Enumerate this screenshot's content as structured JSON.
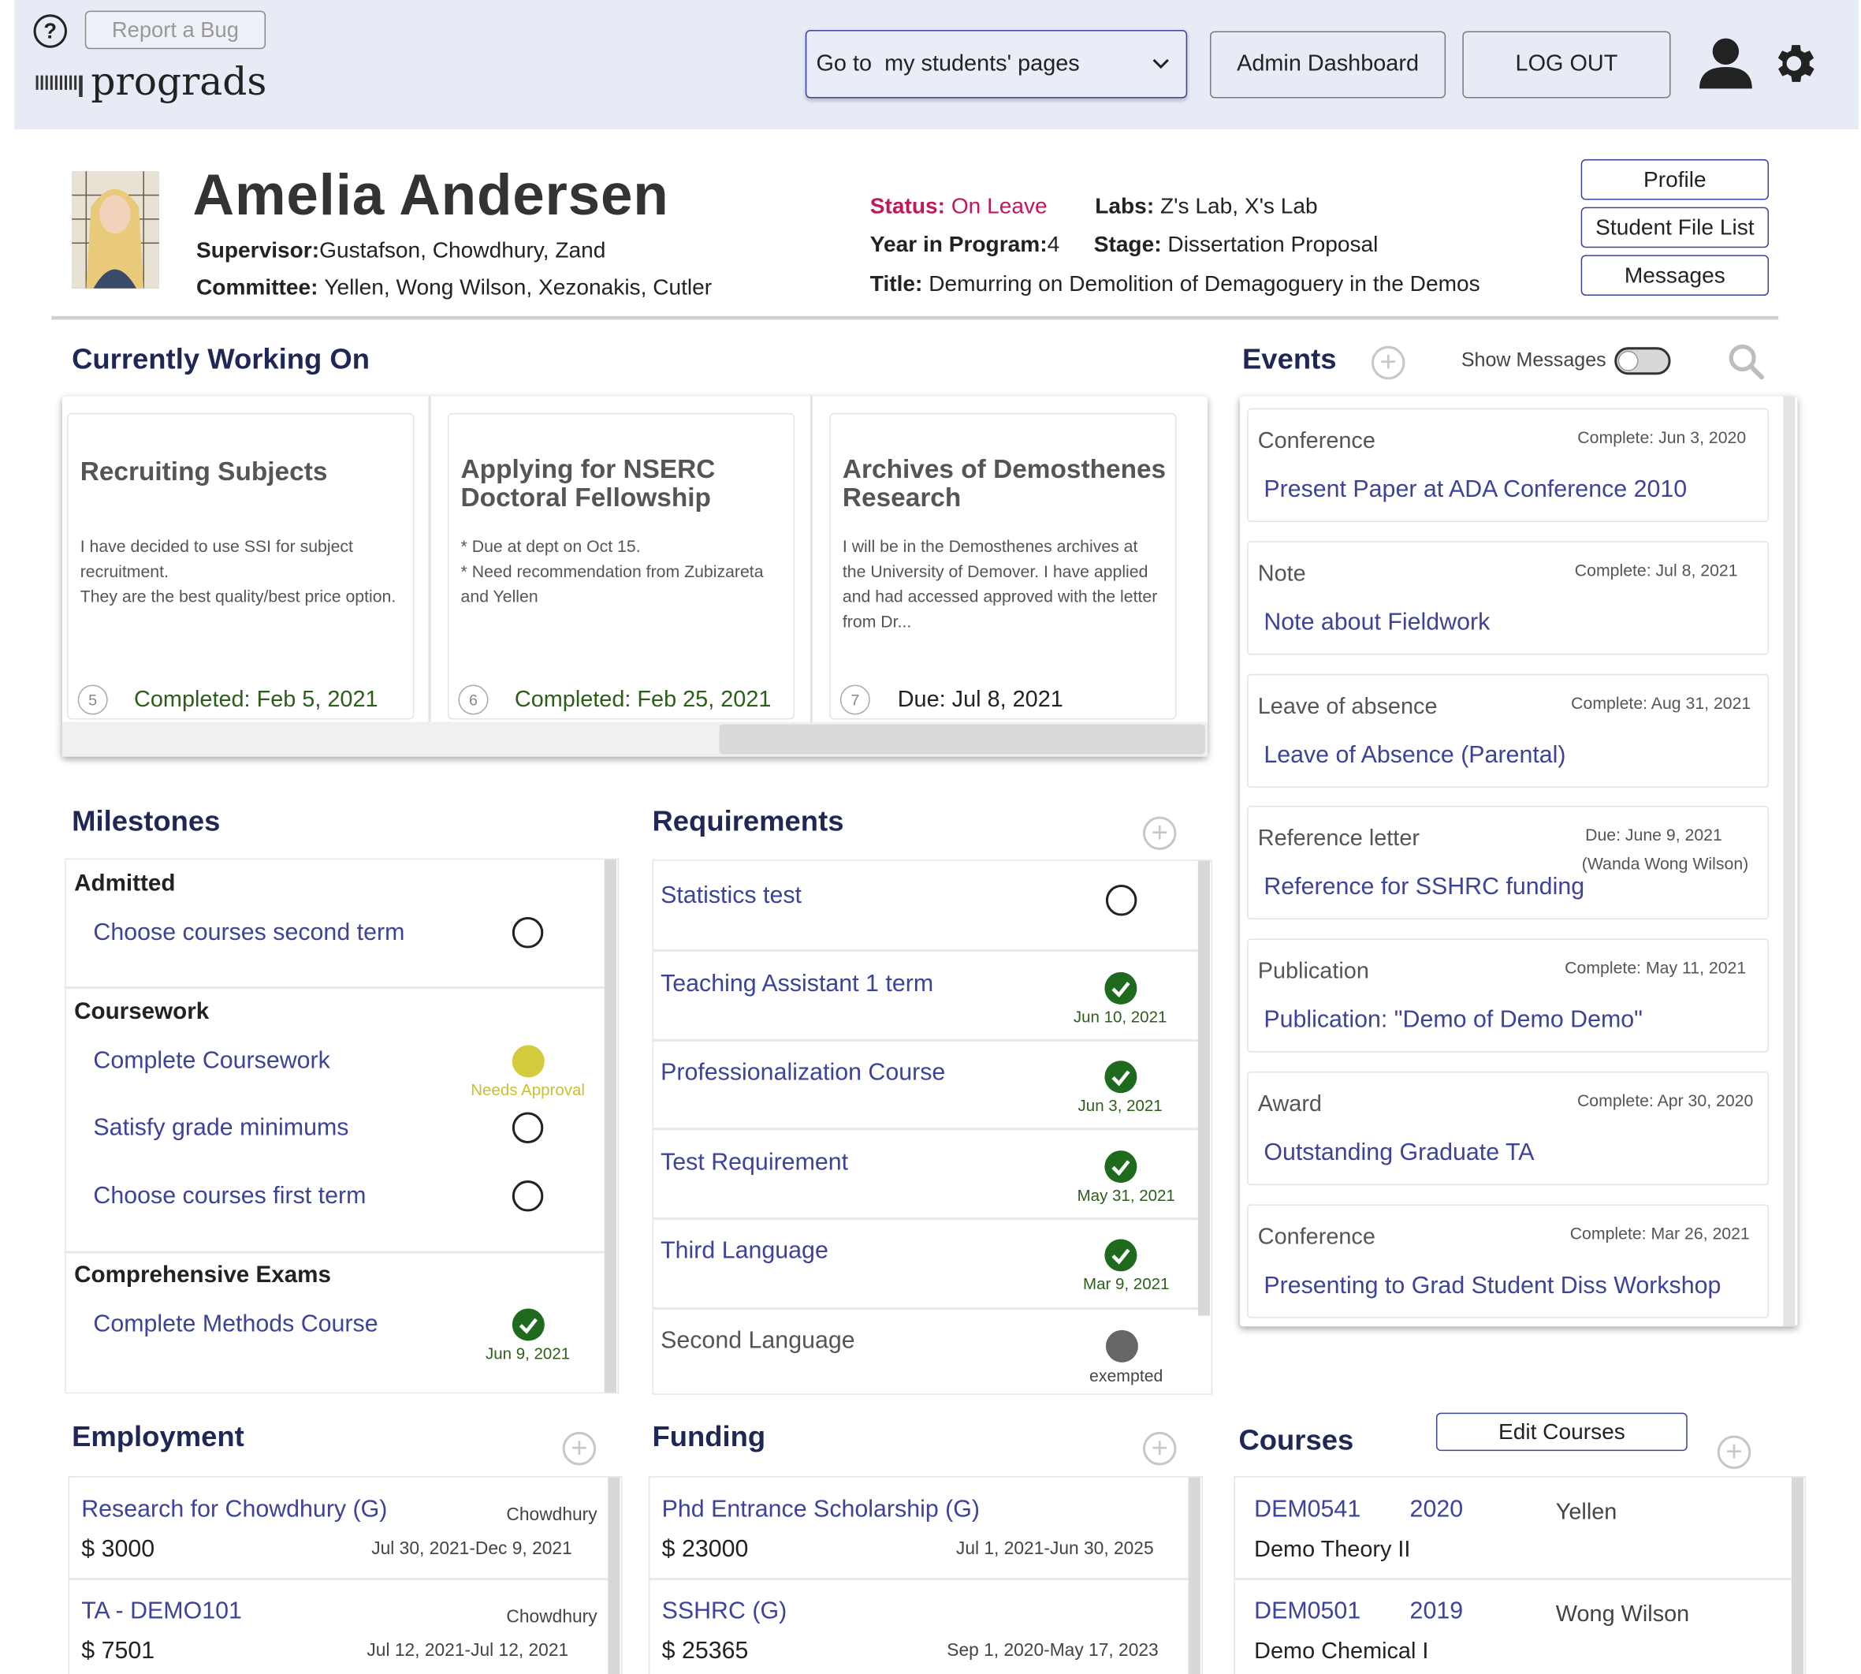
{
  "header": {
    "help_icon": "question-circle-icon",
    "report_bug": "Report a Bug",
    "logo_text": "prograds",
    "goto_select": "Go to  my students' pages",
    "admin_dashboard": "Admin Dashboard",
    "logout": "LOG OUT",
    "user_icon": "user-icon",
    "settings_icon": "gear-icon"
  },
  "student": {
    "name": "Amelia Andersen",
    "supervisor_label": "Supervisor",
    "supervisor": "Gustafson, Chowdhury, Zand",
    "committee_label": "Committee",
    "committee": "Yellen, Wong Wilson, Xezonakis, Cutler",
    "status_label": "Status",
    "status": "On Leave",
    "labs_label": "Labs",
    "labs": "Z's Lab, X's Lab",
    "year_label": "Year in Program",
    "year": "4",
    "stage_label": "Stage",
    "stage": "Dissertation Proposal",
    "title_label": "Title",
    "title": "Demurring on Demolition of Demagoguery in the Demos",
    "buttons": {
      "profile": "Profile",
      "file_list": "Student File List",
      "messages": "Messages"
    },
    "colors": {
      "status": "#c2185b"
    }
  },
  "working_on": {
    "title": "Currently Working On",
    "cards": [
      {
        "num": "5",
        "title": "Recruiting Subjects",
        "desc": "I have decided to use SSI for subject recruitment.\nThey are the best quality/best price option.",
        "status": "Completed: Feb 5, 2021"
      },
      {
        "num": "6",
        "title": "Applying for NSERC Doctoral Fellowship",
        "desc": "* Due at dept on Oct 15.\n* Need recommendation from Zubizareta and Yellen",
        "status": "Completed: Feb 25, 2021"
      },
      {
        "num": "7",
        "title": "Archives of Demosthenes Research",
        "desc": "I will be in the Demosthenes archives at the University of Demover. I have applied and had accessed approved with the letter from Dr...",
        "status": "Due: Jul 8, 2021"
      }
    ]
  },
  "events": {
    "title": "Events",
    "show_messages": "Show Messages",
    "items": [
      {
        "category": "Conference",
        "date": "Complete: Jun 3, 2020",
        "title": "Present Paper at ADA Conference 2010"
      },
      {
        "category": "Note",
        "date": "Complete: Jul 8, 2021",
        "title": "Note about Fieldwork"
      },
      {
        "category": "Leave of absence",
        "date": "Complete: Aug 31, 2021",
        "title": "Leave of Absence (Parental)"
      },
      {
        "category": "Reference letter",
        "date": "Due: June 9, 2021",
        "date2": "(Wanda Wong Wilson)",
        "title": "Reference for SSHRC funding"
      },
      {
        "category": "Publication",
        "date": "Complete: May 11, 2021",
        "title": "Publication: \"Demo of Demo Demo\""
      },
      {
        "category": "Award",
        "date": "Complete: Apr 30, 2020",
        "title": "Outstanding Graduate TA"
      },
      {
        "category": "Conference",
        "date": "Complete: Mar 26, 2021",
        "title": "Presenting to Grad Student Diss Workshop"
      }
    ]
  },
  "milestones": {
    "title": "Milestones",
    "groups": [
      {
        "name": "Admitted",
        "items": [
          {
            "label": "Choose courses second term",
            "state": "open"
          }
        ]
      },
      {
        "name": "Coursework",
        "items": [
          {
            "label": "Complete Coursework",
            "state": "needs-approval",
            "note": "Needs Approval"
          },
          {
            "label": "Satisfy grade minimums",
            "state": "open"
          },
          {
            "label": "Choose courses first term",
            "state": "open"
          }
        ]
      },
      {
        "name": "Comprehensive Exams",
        "items": [
          {
            "label": "Complete Methods Course",
            "state": "done",
            "note": "Jun 9, 2021"
          }
        ]
      }
    ],
    "colors": {
      "needs_approval": "#d4cc3c"
    }
  },
  "requirements": {
    "title": "Requirements",
    "items": [
      {
        "label": "Statistics test",
        "state": "open",
        "note": ""
      },
      {
        "label": "Teaching Assistant 1 term",
        "state": "done",
        "note": "Jun 10, 2021"
      },
      {
        "label": "Professionalization Course",
        "state": "done",
        "note": "Jun 3, 2021"
      },
      {
        "label": "Test Requirement",
        "state": "done",
        "note": "May 31, 2021"
      },
      {
        "label": "Third Language",
        "state": "done",
        "note": "Mar 9, 2021"
      },
      {
        "label": "Second Language",
        "state": "exempted",
        "note": "exempted"
      }
    ]
  },
  "employment": {
    "title": "Employment",
    "items": [
      {
        "title": "Research for Chowdhury (G)",
        "who": "Chowdhury",
        "amount": "$ 3000",
        "dates": "Jul 30, 2021-Dec 9, 2021"
      },
      {
        "title": "TA - DEMO101",
        "who": "Chowdhury",
        "amount": "$ 7501",
        "dates": "Jul 12, 2021-Jul 12, 2021"
      }
    ]
  },
  "funding": {
    "title": "Funding",
    "items": [
      {
        "title": "Phd Entrance Scholarship (G)",
        "amount": "$ 23000",
        "dates": "Jul 1, 2021-Jun 30, 2025"
      },
      {
        "title": "SSHRC (G)",
        "amount": "$ 25365",
        "dates": "Sep 1, 2020-May 17, 2023"
      }
    ]
  },
  "courses": {
    "title": "Courses",
    "edit": "Edit Courses",
    "items": [
      {
        "code": "DEM0541",
        "year": "2020",
        "instructor": "Yellen",
        "name": "Demo Theory II"
      },
      {
        "code": "DEM0501",
        "year": "2019",
        "instructor": "Wong Wilson",
        "name": "Demo Chemical I"
      }
    ]
  }
}
